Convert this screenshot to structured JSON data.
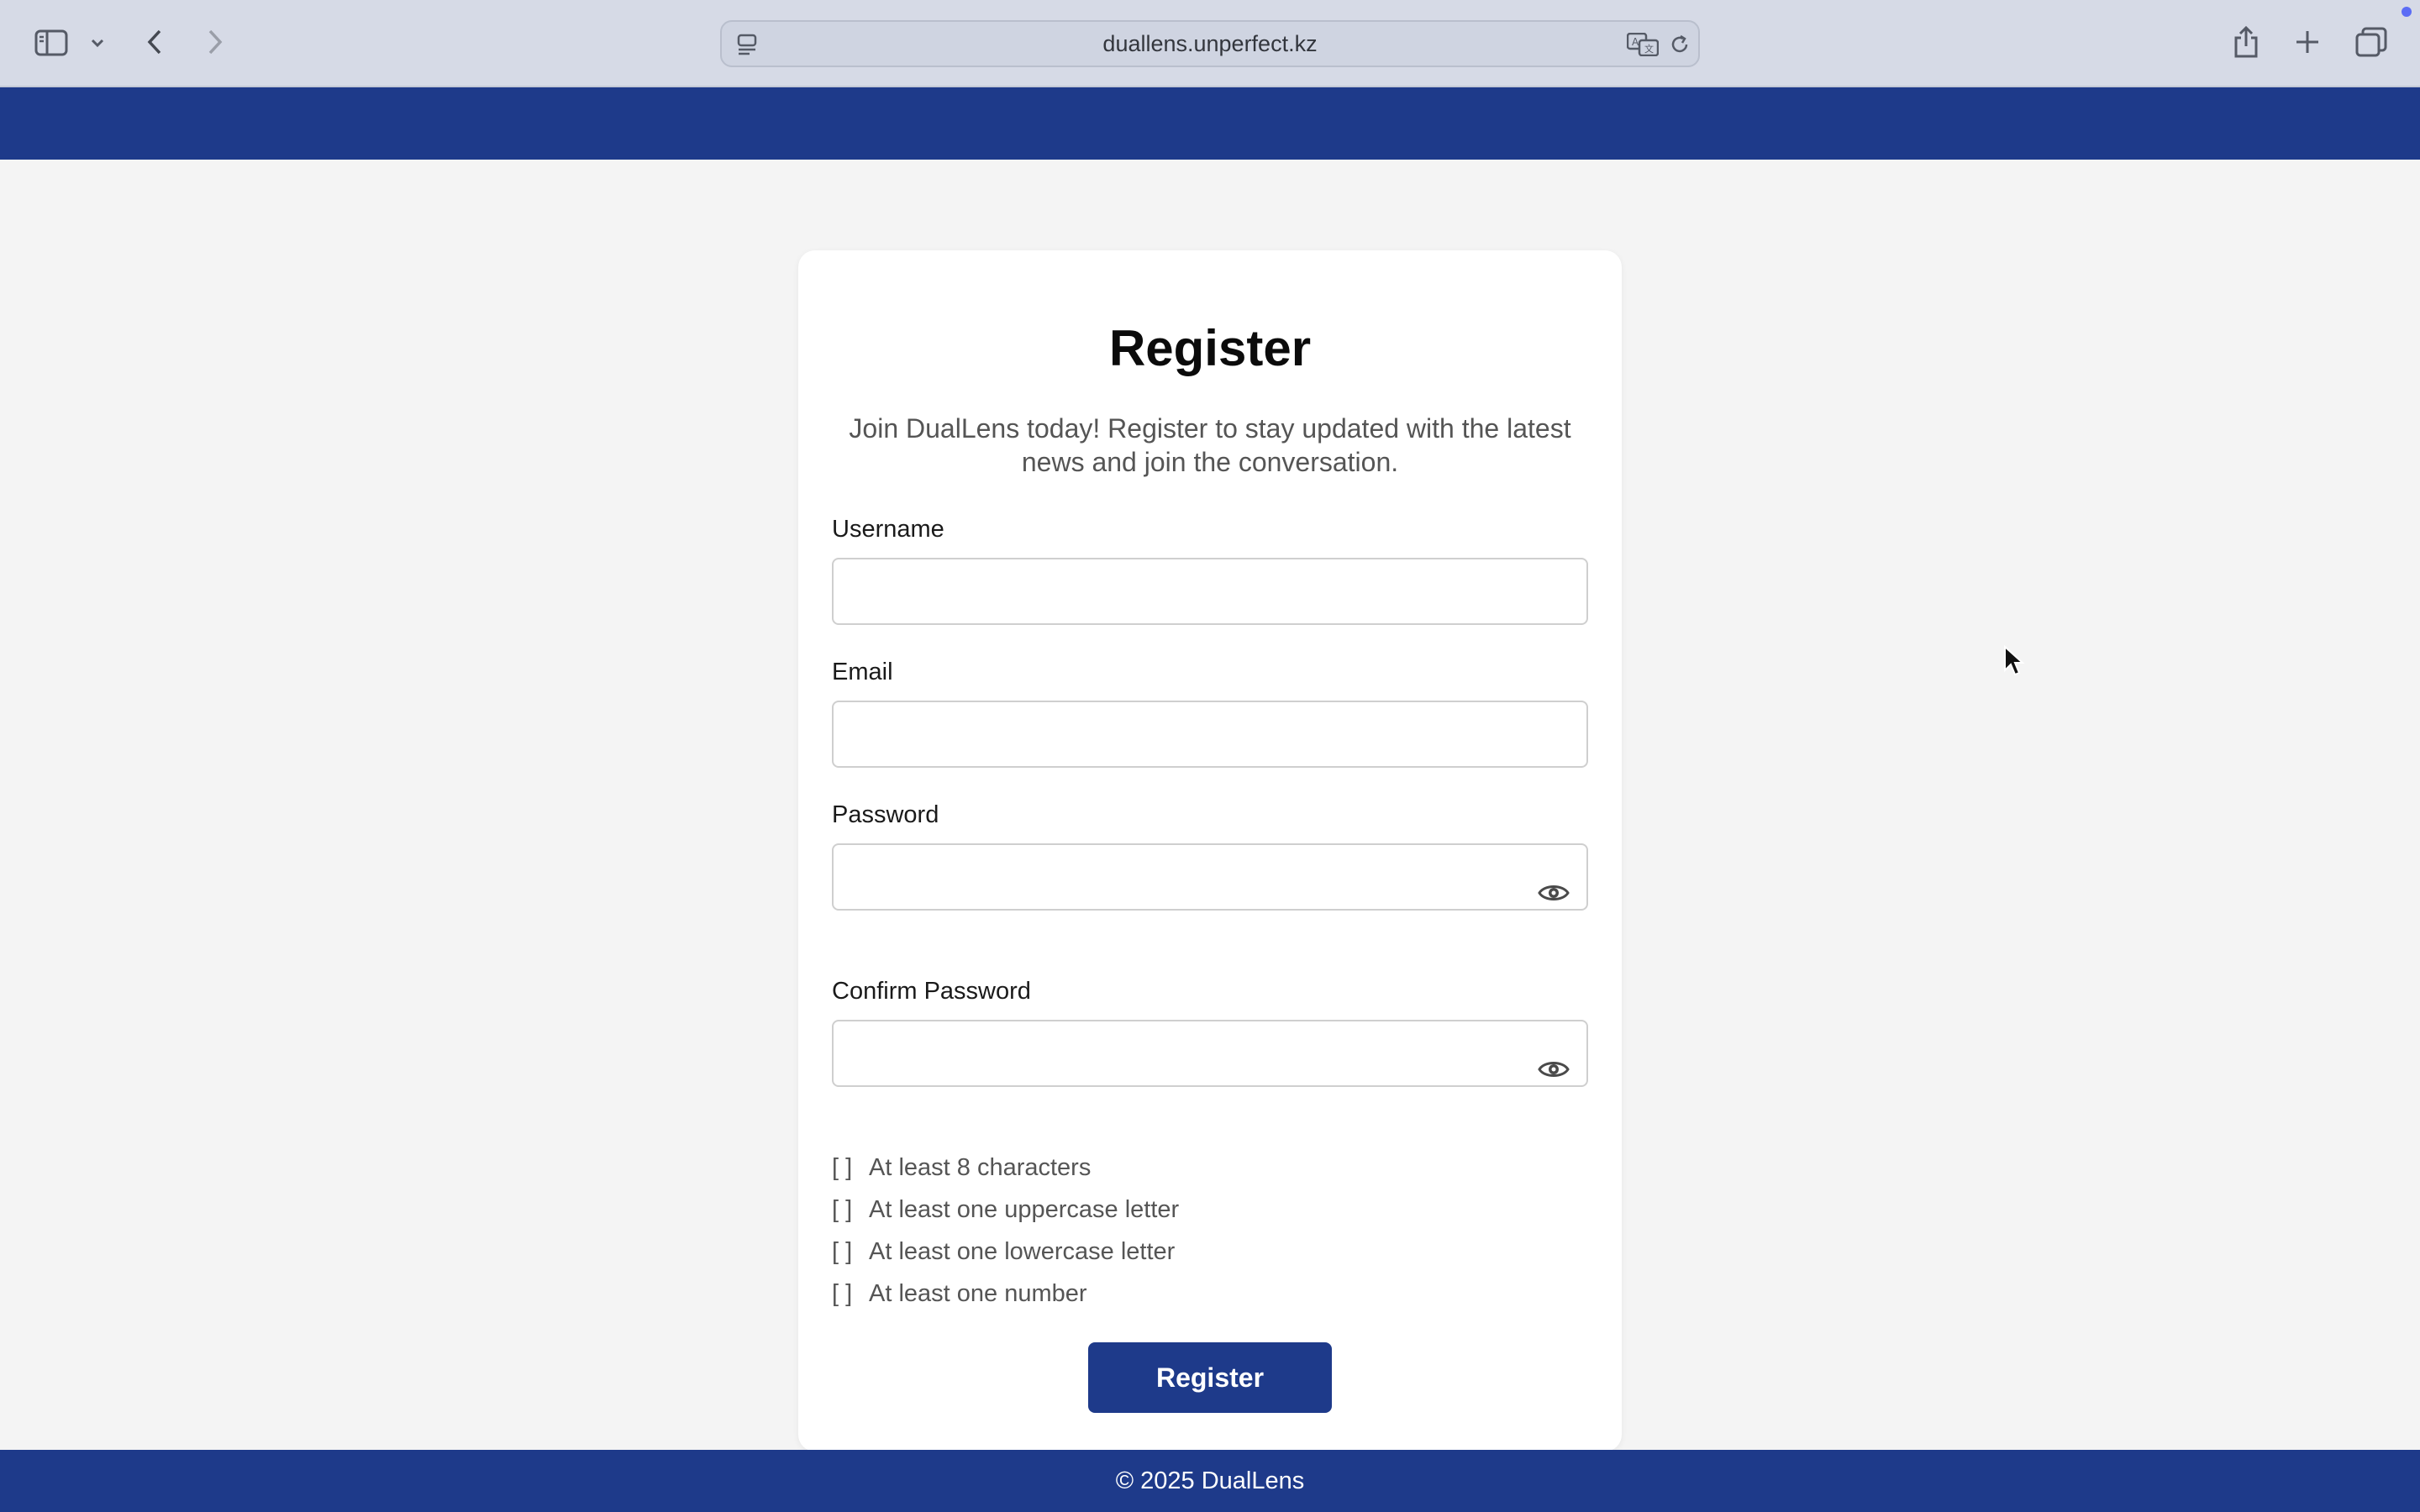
{
  "browser": {
    "url": "duallens.unperfect.kz"
  },
  "colors": {
    "brand": "#1e3a8a",
    "page_bg": "#f4f4f4"
  },
  "form": {
    "title": "Register",
    "subtitle": "Join DualLens today! Register to stay updated with the latest news and join the conversation.",
    "username_label": "Username",
    "username_value": "",
    "email_label": "Email",
    "email_value": "",
    "password_label": "Password",
    "password_value": "",
    "confirm_label": "Confirm Password",
    "confirm_value": "",
    "requirements": [
      {
        "mark": "[ ]",
        "text": "At least 8 characters"
      },
      {
        "mark": "[ ]",
        "text": "At least one uppercase letter"
      },
      {
        "mark": "[ ]",
        "text": "At least one lowercase letter"
      },
      {
        "mark": "[ ]",
        "text": "At least one number"
      }
    ],
    "submit_label": "Register"
  },
  "footer": {
    "text": "© 2025 DualLens"
  },
  "icons": [
    "sidebar-icon",
    "chevron-down-icon",
    "back-icon",
    "forward-icon",
    "reader-icon",
    "translate-icon",
    "reload-icon",
    "share-icon",
    "new-tab-icon",
    "tabs-overview-icon",
    "eye-icon",
    "cursor-icon"
  ]
}
